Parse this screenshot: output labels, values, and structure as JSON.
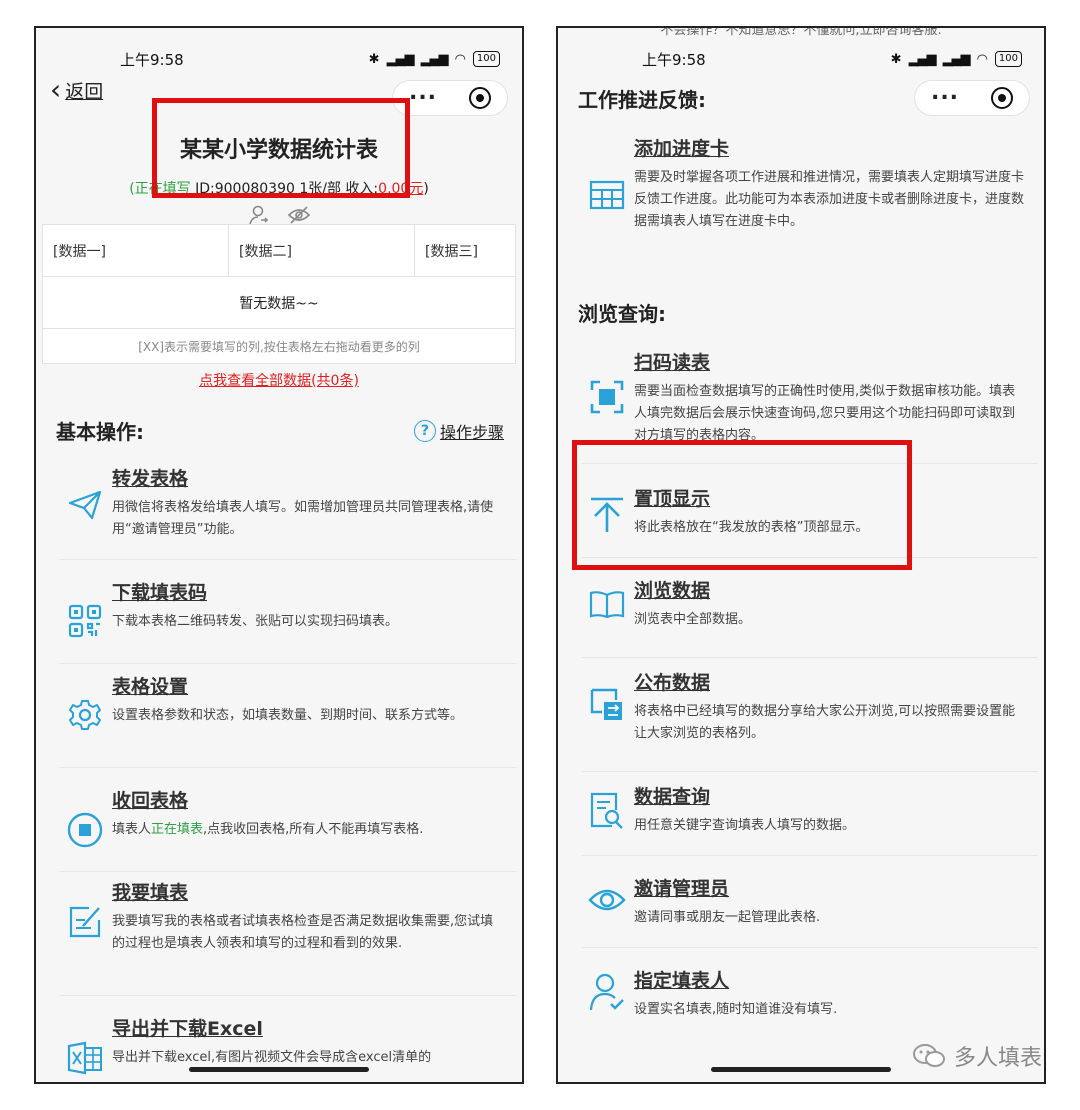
{
  "left": {
    "status": {
      "time": "上午9:58",
      "battery": "100"
    },
    "back_label": "返回",
    "form_title": "某某小学数据统计表",
    "meta": {
      "open_paren": "(",
      "status": "正在填写",
      "id": "ID:900080390",
      "per": "1张/部",
      "income_label": "收入:",
      "income_value": "0.00元",
      "close_paren": ")"
    },
    "table": {
      "headers": [
        "[数据一]",
        "[数据二]",
        "[数据三]"
      ],
      "empty_text": "暂无数据~~",
      "hint": "[XX]表示需要填写的列,按住表格左右拖动看更多的列"
    },
    "view_all": "点我查看全部数据(共0条)",
    "section_basic": "基本操作:",
    "help_label": "操作步骤",
    "items": [
      {
        "title": "转发表格",
        "desc": "用微信将表格发给填表人填写。如需增加管理员共同管理表格,请使用“邀请管理员”功能。"
      },
      {
        "title": "下载填表码",
        "desc": "下载本表格二维码转发、张贴可以实现扫码填表。"
      },
      {
        "title": "表格设置",
        "desc": "设置表格参数和状态，如填表数量、到期时间、联系方式等。"
      },
      {
        "title": "收回表格",
        "desc_pre": "填表人",
        "desc_green": "正在填表",
        "desc_post": ",点我收回表格,所有人不能再填写表格."
      },
      {
        "title": "我要填表",
        "desc": "我要填写我的表格或者试填表格检查是否满足数据收集需要,您试填的过程也是填表人领表和填写的过程和看到的效果."
      },
      {
        "title": "导出并下载Excel",
        "desc": "导出并下载excel,有图片视频文件会导成含excel清单的"
      }
    ]
  },
  "right": {
    "top_text": "不会操作？不知道意思？不懂就问,立即咨询客服.",
    "status": {
      "time": "上午9:58",
      "battery": "100"
    },
    "section_progress": "工作推进反馈:",
    "progress_item": {
      "title": "添加进度卡",
      "desc": "需要及时掌握各项工作进展和推进情况，需要填表人定期填写进度卡反馈工作进度。此功能可为本表添加进度卡或者删除进度卡，进度数据需填表人填写在进度卡中。"
    },
    "section_browse": "浏览查询:",
    "items": [
      {
        "title": "扫码读表",
        "desc": "需要当面检查数据填写的正确性时使用,类似于数据审核功能。填表人填完数据后会展示快速查询码,您只要用这个功能扫码即可读取到对方填写的表格内容。"
      },
      {
        "title": "置顶显示",
        "desc": "将此表格放在“我发放的表格”顶部显示。"
      },
      {
        "title": "浏览数据",
        "desc": "浏览表中全部数据。"
      },
      {
        "title": "公布数据",
        "desc": "将表格中已经填写的数据分享给大家公开浏览,可以按照需要设置能让大家浏览的表格列。"
      },
      {
        "title": "数据查询",
        "desc": "用任意关键字查询填表人填写的数据。"
      },
      {
        "title": "邀请管理员",
        "desc": "邀请同事或朋友一起管理此表格."
      },
      {
        "title": "指定填表人",
        "desc": "设置实名填表,随时知道谁没有填写."
      }
    ]
  },
  "watermark": "多人填表",
  "colors": {
    "accent": "#2aa2d8",
    "highlight": "#e01010",
    "active": "#2ea043"
  }
}
